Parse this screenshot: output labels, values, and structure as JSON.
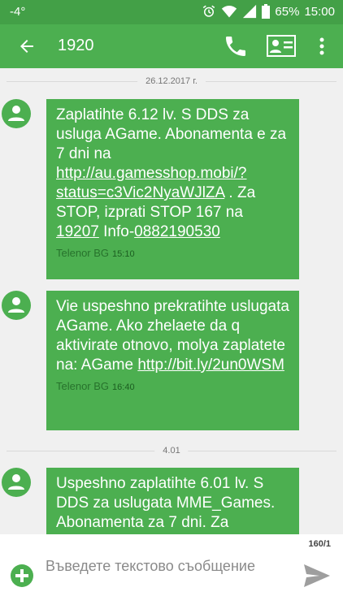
{
  "status_bar": {
    "temperature": "-4°",
    "battery": "65%",
    "time": "15:00"
  },
  "app_bar": {
    "title": "1920"
  },
  "conversation": {
    "date_dividers": [
      "26.12.2017 г.",
      "4.01"
    ],
    "messages": [
      {
        "text_parts": [
          "Zaplatihte 6.12 lv. S DDS za usluga AGame. Abonamenta e za 7 dni na ",
          "http://au.gamesshop.mobi/?status=c3Vic2NyaWJlZA",
          " . Za STOP, izprati STOP 167 na ",
          "19207",
          " Info-",
          "0882190530"
        ],
        "sender": "Telenor BG",
        "time": "15:10"
      },
      {
        "text_parts": [
          "Vie uspeshno prekratihte uslugata AGame. Ako zhelaete da q aktivirate otnovo, molya zaplatete na: AGame ",
          "http://bit.ly/2un0WSM"
        ],
        "sender": "Telenor BG",
        "time": "16:40"
      },
      {
        "text_parts": [
          "Uspeshno zaplatihte 6.01 lv. S DDS za uslugata MME_Games. Abonamenta za 7 dni. Za"
        ]
      }
    ]
  },
  "composer": {
    "char_counter": "160/1",
    "placeholder": "Въведете текстово съобщение"
  },
  "icons": {
    "back": "arrow-back-icon",
    "call": "phone-icon",
    "contact": "contact-card-icon",
    "more": "more-vert-icon",
    "avatar": "person-icon",
    "attach": "add-circle-icon",
    "send": "send-icon"
  },
  "colors": {
    "primary": "#4caf50",
    "status_bar": "#43a047",
    "background": "#f0f0f0"
  }
}
